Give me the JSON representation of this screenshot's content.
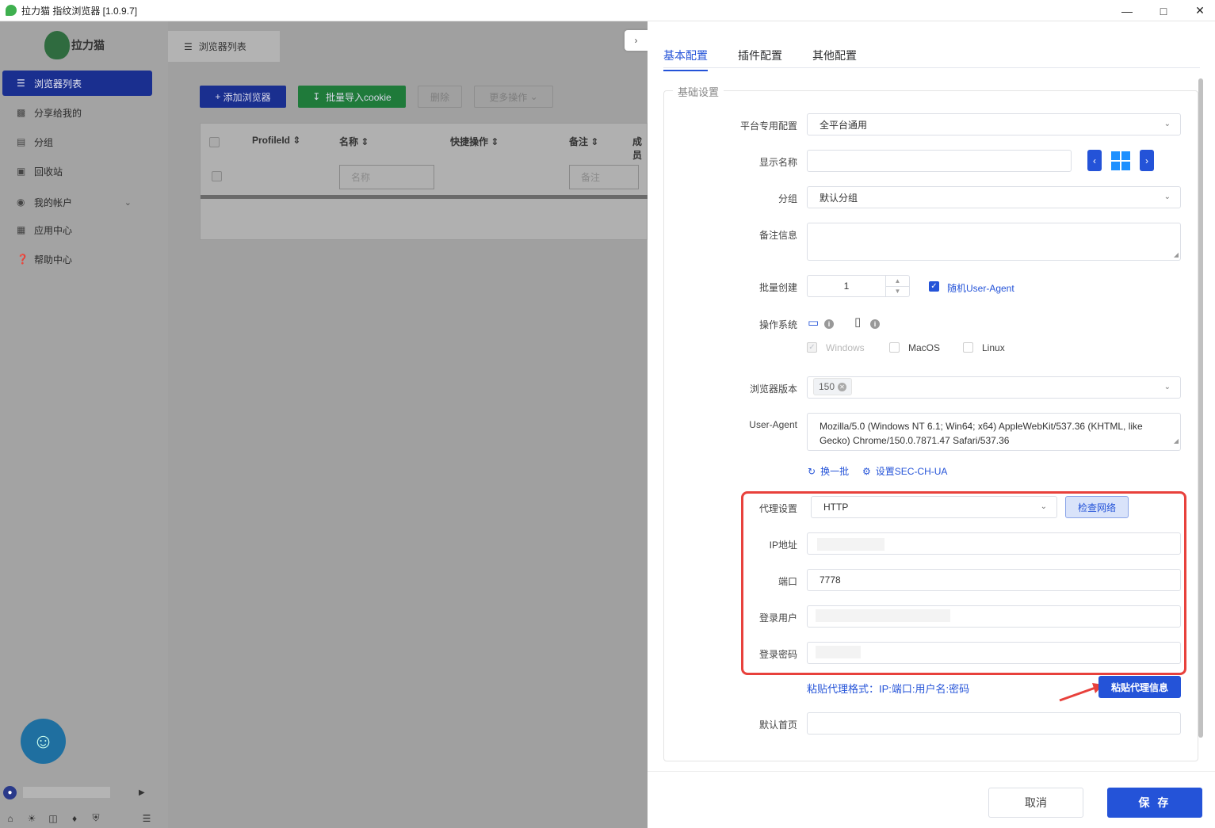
{
  "window": {
    "title": "拉力猫 指纹浏览器 [1.0.9.7]"
  },
  "sidebar": {
    "brand": "拉力猫",
    "items": [
      {
        "label": "浏览器列表",
        "icon": "list-icon",
        "active": true
      },
      {
        "label": "分享给我的",
        "icon": "share-icon"
      },
      {
        "label": "分组",
        "icon": "group-icon"
      },
      {
        "label": "回收站",
        "icon": "trash-icon"
      },
      {
        "label": "我的帐户",
        "icon": "account-icon",
        "expandable": true
      },
      {
        "label": "应用中心",
        "icon": "apps-icon"
      },
      {
        "label": "帮助中心",
        "icon": "help-icon"
      }
    ]
  },
  "content": {
    "tab_label": "浏览器列表",
    "toolbar": {
      "add": "添加浏览器",
      "import": "批量导入cookie",
      "delete": "删除",
      "more": "更多操作"
    },
    "table": {
      "columns": [
        "ProfileId",
        "名称",
        "快捷操作",
        "备注",
        "成员"
      ],
      "filter_name_placeholder": "名称",
      "filter_note_placeholder": "备注"
    }
  },
  "drawer": {
    "tabs": [
      "基本配置",
      "插件配置",
      "其他配置"
    ],
    "section_title": "基础设置",
    "fields": {
      "platform": {
        "label": "平台专用配置",
        "value": "全平台通用"
      },
      "display_name": {
        "label": "显示名称",
        "value": ""
      },
      "group": {
        "label": "分组",
        "value": "默认分组"
      },
      "note": {
        "label": "备注信息",
        "value": ""
      },
      "batch": {
        "label": "批量创建",
        "value": "1",
        "random_ua_label": "随机User-Agent",
        "random_ua_checked": true
      },
      "os": {
        "label": "操作系统",
        "options": [
          "Windows",
          "MacOS",
          "Linux"
        ],
        "checked": "Windows"
      },
      "browser_version": {
        "label": "浏览器版本",
        "value": "150"
      },
      "user_agent": {
        "label": "User-Agent",
        "value": "Mozilla/5.0 (Windows NT 6.1; Win64; x64) AppleWebKit/537.36 (KHTML, like Gecko) Chrome/150.0.7871.47 Safari/537.36"
      },
      "ua_actions": {
        "refresh": "换一批",
        "sec_ch_ua": "设置SEC-CH-UA"
      },
      "proxy": {
        "label": "代理设置",
        "value": "HTTP",
        "check_button": "检查网络"
      },
      "ip": {
        "label": "IP地址",
        "value": ""
      },
      "port": {
        "label": "端口",
        "value": "7778"
      },
      "username": {
        "label": "登录用户",
        "value": ""
      },
      "password": {
        "label": "登录密码",
        "value": ""
      },
      "paste_hint": "粘贴代理格式：IP:端口:用户名:密码",
      "paste_button": "粘贴代理信息",
      "homepage": {
        "label": "默认首页",
        "value": ""
      }
    },
    "footer": {
      "cancel": "取消",
      "save": "保 存"
    },
    "colors": {
      "accent": "#2453d8",
      "highlight": "#e8413c"
    }
  }
}
